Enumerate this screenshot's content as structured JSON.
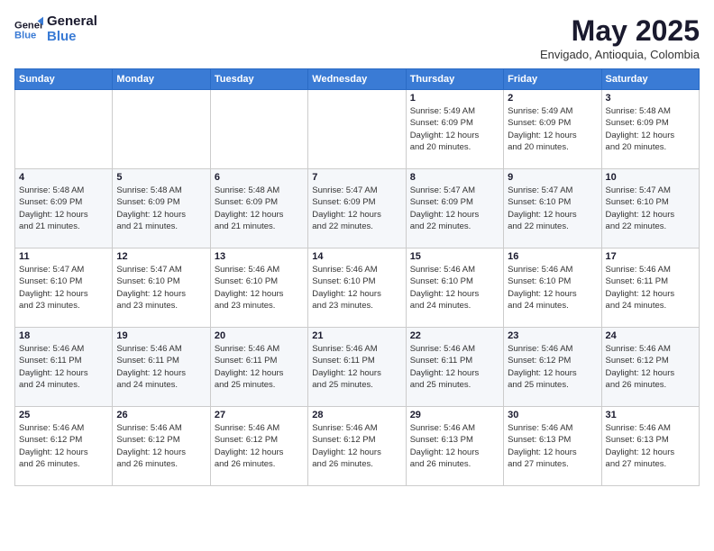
{
  "logo": {
    "line1": "General",
    "line2": "Blue"
  },
  "title": "May 2025",
  "subtitle": "Envigado, Antioquia, Colombia",
  "days_of_week": [
    "Sunday",
    "Monday",
    "Tuesday",
    "Wednesday",
    "Thursday",
    "Friday",
    "Saturday"
  ],
  "weeks": [
    [
      {
        "day": "",
        "info": ""
      },
      {
        "day": "",
        "info": ""
      },
      {
        "day": "",
        "info": ""
      },
      {
        "day": "",
        "info": ""
      },
      {
        "day": "1",
        "info": "Sunrise: 5:49 AM\nSunset: 6:09 PM\nDaylight: 12 hours\nand 20 minutes."
      },
      {
        "day": "2",
        "info": "Sunrise: 5:49 AM\nSunset: 6:09 PM\nDaylight: 12 hours\nand 20 minutes."
      },
      {
        "day": "3",
        "info": "Sunrise: 5:48 AM\nSunset: 6:09 PM\nDaylight: 12 hours\nand 20 minutes."
      }
    ],
    [
      {
        "day": "4",
        "info": "Sunrise: 5:48 AM\nSunset: 6:09 PM\nDaylight: 12 hours\nand 21 minutes."
      },
      {
        "day": "5",
        "info": "Sunrise: 5:48 AM\nSunset: 6:09 PM\nDaylight: 12 hours\nand 21 minutes."
      },
      {
        "day": "6",
        "info": "Sunrise: 5:48 AM\nSunset: 6:09 PM\nDaylight: 12 hours\nand 21 minutes."
      },
      {
        "day": "7",
        "info": "Sunrise: 5:47 AM\nSunset: 6:09 PM\nDaylight: 12 hours\nand 22 minutes."
      },
      {
        "day": "8",
        "info": "Sunrise: 5:47 AM\nSunset: 6:09 PM\nDaylight: 12 hours\nand 22 minutes."
      },
      {
        "day": "9",
        "info": "Sunrise: 5:47 AM\nSunset: 6:10 PM\nDaylight: 12 hours\nand 22 minutes."
      },
      {
        "day": "10",
        "info": "Sunrise: 5:47 AM\nSunset: 6:10 PM\nDaylight: 12 hours\nand 22 minutes."
      }
    ],
    [
      {
        "day": "11",
        "info": "Sunrise: 5:47 AM\nSunset: 6:10 PM\nDaylight: 12 hours\nand 23 minutes."
      },
      {
        "day": "12",
        "info": "Sunrise: 5:47 AM\nSunset: 6:10 PM\nDaylight: 12 hours\nand 23 minutes."
      },
      {
        "day": "13",
        "info": "Sunrise: 5:46 AM\nSunset: 6:10 PM\nDaylight: 12 hours\nand 23 minutes."
      },
      {
        "day": "14",
        "info": "Sunrise: 5:46 AM\nSunset: 6:10 PM\nDaylight: 12 hours\nand 23 minutes."
      },
      {
        "day": "15",
        "info": "Sunrise: 5:46 AM\nSunset: 6:10 PM\nDaylight: 12 hours\nand 24 minutes."
      },
      {
        "day": "16",
        "info": "Sunrise: 5:46 AM\nSunset: 6:10 PM\nDaylight: 12 hours\nand 24 minutes."
      },
      {
        "day": "17",
        "info": "Sunrise: 5:46 AM\nSunset: 6:11 PM\nDaylight: 12 hours\nand 24 minutes."
      }
    ],
    [
      {
        "day": "18",
        "info": "Sunrise: 5:46 AM\nSunset: 6:11 PM\nDaylight: 12 hours\nand 24 minutes."
      },
      {
        "day": "19",
        "info": "Sunrise: 5:46 AM\nSunset: 6:11 PM\nDaylight: 12 hours\nand 24 minutes."
      },
      {
        "day": "20",
        "info": "Sunrise: 5:46 AM\nSunset: 6:11 PM\nDaylight: 12 hours\nand 25 minutes."
      },
      {
        "day": "21",
        "info": "Sunrise: 5:46 AM\nSunset: 6:11 PM\nDaylight: 12 hours\nand 25 minutes."
      },
      {
        "day": "22",
        "info": "Sunrise: 5:46 AM\nSunset: 6:11 PM\nDaylight: 12 hours\nand 25 minutes."
      },
      {
        "day": "23",
        "info": "Sunrise: 5:46 AM\nSunset: 6:12 PM\nDaylight: 12 hours\nand 25 minutes."
      },
      {
        "day": "24",
        "info": "Sunrise: 5:46 AM\nSunset: 6:12 PM\nDaylight: 12 hours\nand 26 minutes."
      }
    ],
    [
      {
        "day": "25",
        "info": "Sunrise: 5:46 AM\nSunset: 6:12 PM\nDaylight: 12 hours\nand 26 minutes."
      },
      {
        "day": "26",
        "info": "Sunrise: 5:46 AM\nSunset: 6:12 PM\nDaylight: 12 hours\nand 26 minutes."
      },
      {
        "day": "27",
        "info": "Sunrise: 5:46 AM\nSunset: 6:12 PM\nDaylight: 12 hours\nand 26 minutes."
      },
      {
        "day": "28",
        "info": "Sunrise: 5:46 AM\nSunset: 6:12 PM\nDaylight: 12 hours\nand 26 minutes."
      },
      {
        "day": "29",
        "info": "Sunrise: 5:46 AM\nSunset: 6:13 PM\nDaylight: 12 hours\nand 26 minutes."
      },
      {
        "day": "30",
        "info": "Sunrise: 5:46 AM\nSunset: 6:13 PM\nDaylight: 12 hours\nand 27 minutes."
      },
      {
        "day": "31",
        "info": "Sunrise: 5:46 AM\nSunset: 6:13 PM\nDaylight: 12 hours\nand 27 minutes."
      }
    ]
  ]
}
